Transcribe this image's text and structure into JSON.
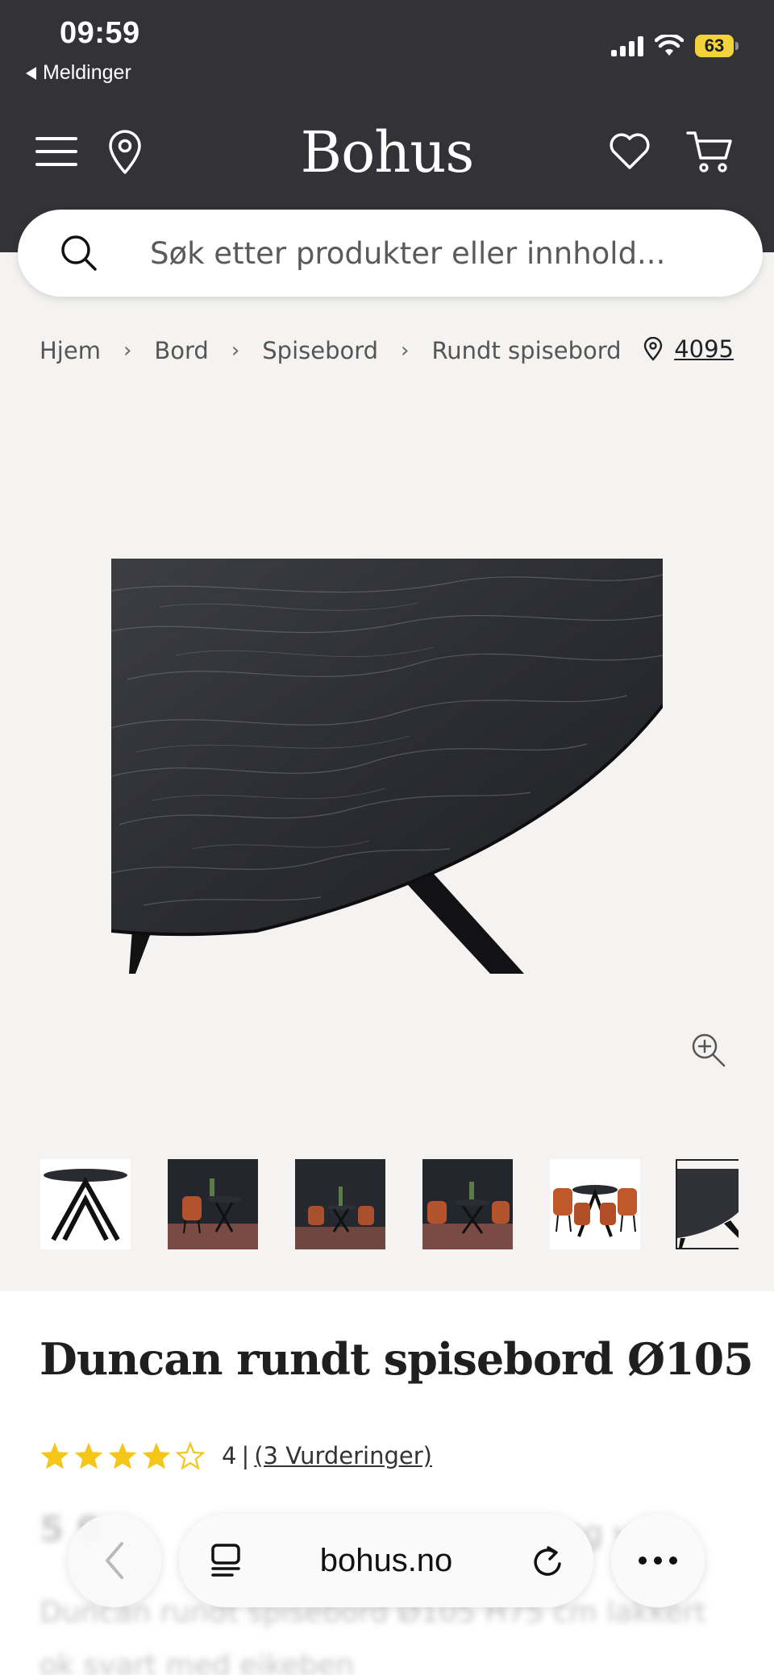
{
  "status_bar": {
    "time": "09:59",
    "back_label": "Meldinger",
    "battery": "63"
  },
  "header": {
    "logo": "Bohus",
    "search_placeholder": "Søk etter produkter eller innhold..."
  },
  "breadcrumb": {
    "items": [
      "Hjem",
      "Bord",
      "Spisebord",
      "Rundt spisebord"
    ],
    "store_number": "4095"
  },
  "gallery": {
    "thumbnail_count": 6,
    "active_index": 5
  },
  "product": {
    "title": "Duncan rundt spisebord Ø105",
    "rating_value": "4",
    "rating_separator": "|",
    "reviews_link": "(3 Vurderinger)",
    "stars_filled": 4,
    "stars_total": 5,
    "star_color": "#f5c518"
  },
  "obscured": {
    "price": "5 9",
    "right_text": "ng valg",
    "desc_line1": "Duncan rundt spisebord Ø105 H75 cm lakkert",
    "desc_line2": "ok svart med eikeben"
  },
  "browser_bar": {
    "domain": "bohus.no"
  }
}
